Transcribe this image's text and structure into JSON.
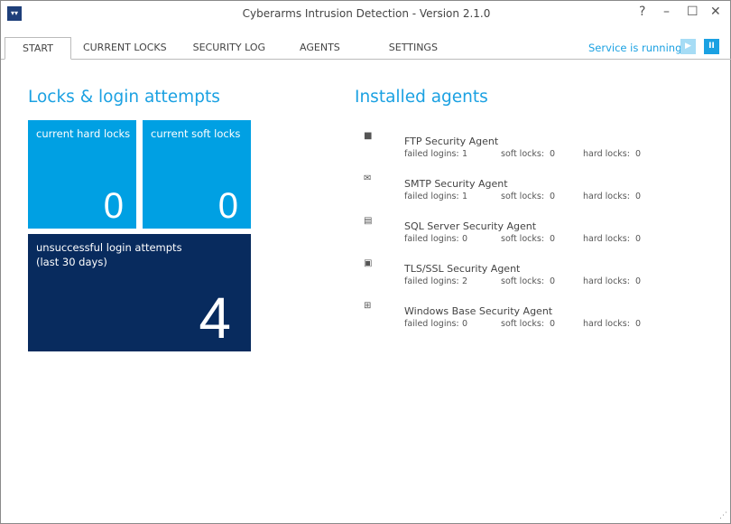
{
  "window": {
    "title": "Cyberarms Intrusion Detection - Version 2.1.0",
    "help": "?",
    "minimize": "–",
    "maximize": "☐",
    "close": "✕"
  },
  "tabs": [
    {
      "label": "START",
      "active": true
    },
    {
      "label": "CURRENT LOCKS"
    },
    {
      "label": "SECURITY LOG"
    },
    {
      "label": "AGENTS"
    },
    {
      "label": "SETTINGS"
    }
  ],
  "service": {
    "status": "Service is running",
    "play": "▶",
    "pause": "II"
  },
  "locks": {
    "heading": "Locks & login attempts",
    "hard": {
      "label": "current hard locks",
      "value": "0"
    },
    "soft": {
      "label": "current soft locks",
      "value": "0"
    },
    "attempts": {
      "label_line1": "unsuccessful login attempts",
      "label_line2": "(last 30 days)",
      "value": "4"
    }
  },
  "agents": {
    "heading": "Installed agents",
    "labels": {
      "failed": "failed logins:",
      "soft": "soft locks:",
      "hard": "hard locks:"
    },
    "items": [
      {
        "icon": "folder-icon",
        "glyph": "■",
        "name": "FTP Security Agent",
        "failed": "1",
        "soft": "0",
        "hard": "0"
      },
      {
        "icon": "mail-icon",
        "glyph": "✉",
        "name": "SMTP Security Agent",
        "failed": "1",
        "soft": "0",
        "hard": "0"
      },
      {
        "icon": "database-check-icon",
        "glyph": "▤",
        "name": "SQL Server Security Agent",
        "failed": "0",
        "soft": "0",
        "hard": "0"
      },
      {
        "icon": "monitor-icon",
        "glyph": "▣",
        "name": "TLS/SSL Security Agent",
        "failed": "2",
        "soft": "0",
        "hard": "0"
      },
      {
        "icon": "windows-icon",
        "glyph": "⊞",
        "name": "Windows Base Security Agent",
        "failed": "0",
        "soft": "0",
        "hard": "0"
      }
    ]
  }
}
